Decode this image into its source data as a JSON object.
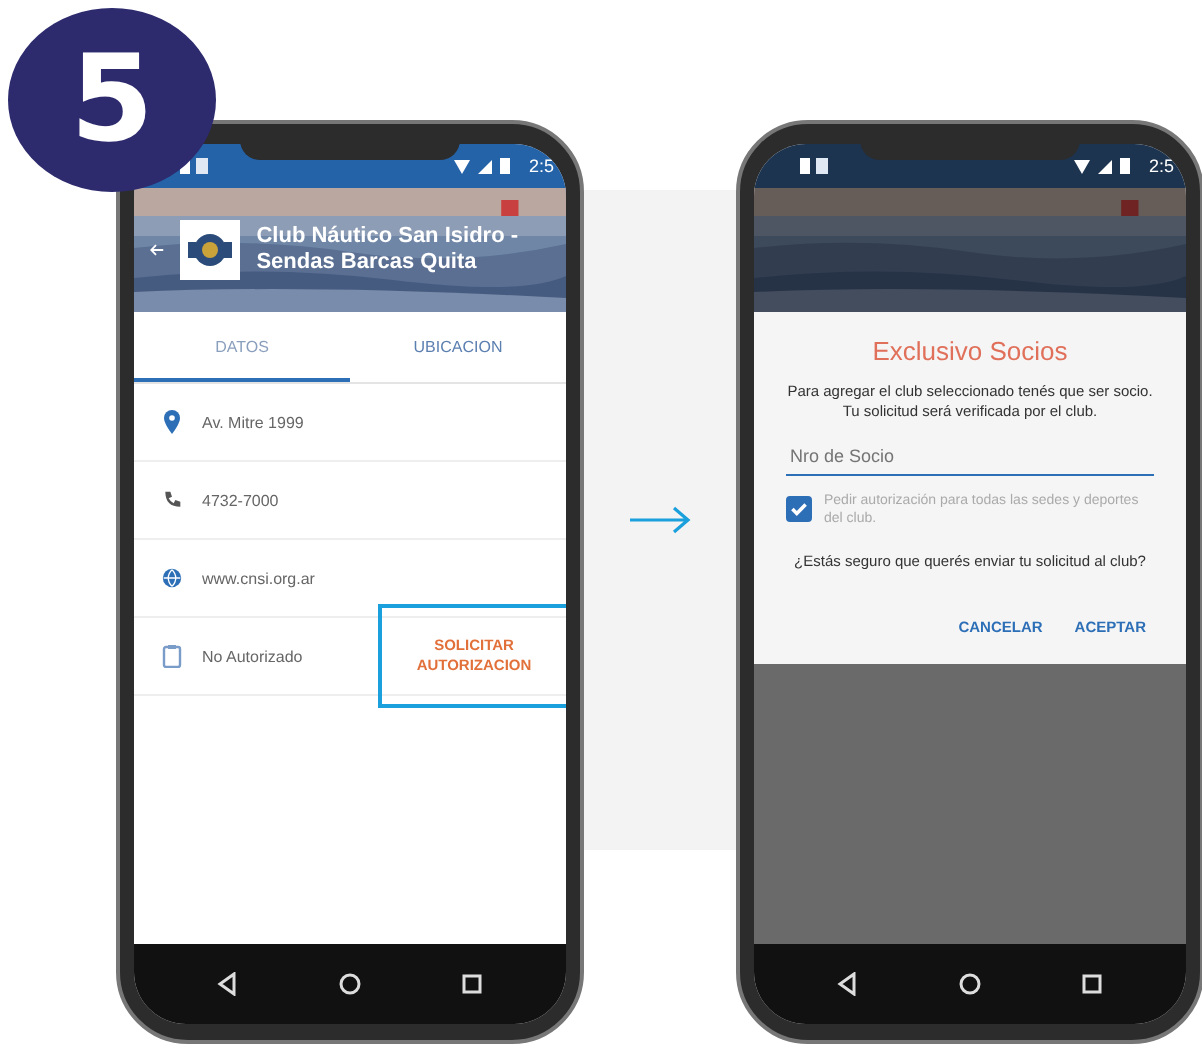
{
  "step_badge": "5",
  "left_screen": {
    "status_time": "2:5",
    "header": {
      "title": "Club Náutico San Isidro - Sendas Barcas Quita"
    },
    "tabs": [
      {
        "label": "DATOS",
        "selected": true
      },
      {
        "label": "UBICACION",
        "selected": false
      }
    ],
    "info_rows": [
      {
        "kind": "address",
        "text": "Av. Mitre 1999"
      },
      {
        "kind": "phone",
        "text": "4732-7000"
      },
      {
        "kind": "web",
        "text": "www.cnsi.org.ar"
      },
      {
        "kind": "status",
        "text": "No Autorizado",
        "action": "SOLICITAR AUTORIZACION",
        "highlighted": true
      }
    ]
  },
  "right_screen": {
    "status_time": "2:5",
    "dialog": {
      "title": "Exclusivo Socios",
      "message": "Para agregar el club seleccionado tenés que ser socio. Tu solicitud será verificada por el club.",
      "field": {
        "placeholder": "Nro de Socio"
      },
      "checkbox": {
        "label": "Pedir autorización para todas las sedes y deportes del club.",
        "checked": true
      },
      "question": "¿Estás seguro que querés enviar tu solicitud al club?",
      "buttons": [
        "CANCELAR",
        "ACEPTAR"
      ]
    }
  }
}
